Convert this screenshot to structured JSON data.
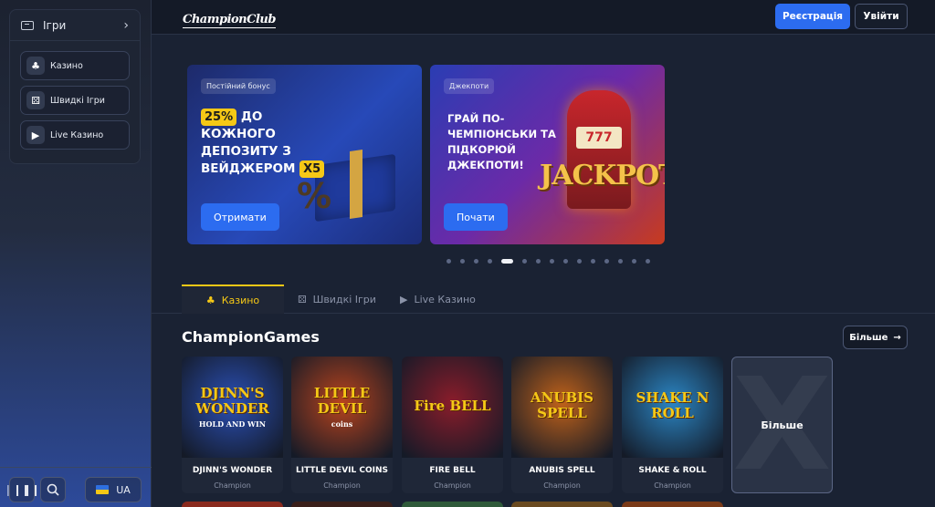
{
  "sidebar": {
    "header_label": "Ігри",
    "items": [
      {
        "label": "Казино",
        "icon": "casino-icon"
      },
      {
        "label": "Швидкі Ігри",
        "icon": "dice-icon"
      },
      {
        "label": "Live Казино",
        "icon": "tv-icon"
      }
    ],
    "language": "UA"
  },
  "header": {
    "logo": "ChampionClub",
    "register_label": "Реєстрація",
    "login_label": "Увійти"
  },
  "banners": [
    {
      "tag": "Постійний бонус",
      "pill": "25%",
      "title_rest": "до кожного депозиту з вейджером",
      "pill2": "x5",
      "button": "Отримати"
    },
    {
      "tag": "Джекпоти",
      "title": "Грай по-чемпіонськи та підкорюй джекпоти!",
      "art_text": "JACKPOT",
      "slot_text": "777",
      "button": "Почати"
    }
  ],
  "carousel": {
    "total": 15,
    "active": 4
  },
  "tabs": [
    {
      "label": "Казино",
      "active": true
    },
    {
      "label": "Швидкі Ігри",
      "active": false
    },
    {
      "label": "Live Казино",
      "active": false
    }
  ],
  "section": {
    "title": "ChampionGames",
    "more_label": "Більше",
    "more_card_label": "Більше"
  },
  "games": [
    {
      "name": "DJINN'S WONDER",
      "provider": "Champion",
      "art": "DJINN'S WONDER",
      "sub": "HOLD AND WIN",
      "color": "#2a4fb5"
    },
    {
      "name": "LITTLE DEVIL COINS",
      "provider": "Champion",
      "art": "LITTLE DEVIL",
      "sub": "coins",
      "color": "#b8431d"
    },
    {
      "name": "FIRE BELL",
      "provider": "Champion",
      "art": "Fire BELL",
      "sub": "",
      "color": "#8a1c2a"
    },
    {
      "name": "ANUBIS SPELL",
      "provider": "Champion",
      "art": "ANUBIS SPELL",
      "sub": "",
      "color": "#c0621a"
    },
    {
      "name": "SHAKE & ROLL",
      "provider": "Champion",
      "art": "SHAKE N ROLL",
      "sub": "",
      "color": "#2b86c4"
    }
  ]
}
